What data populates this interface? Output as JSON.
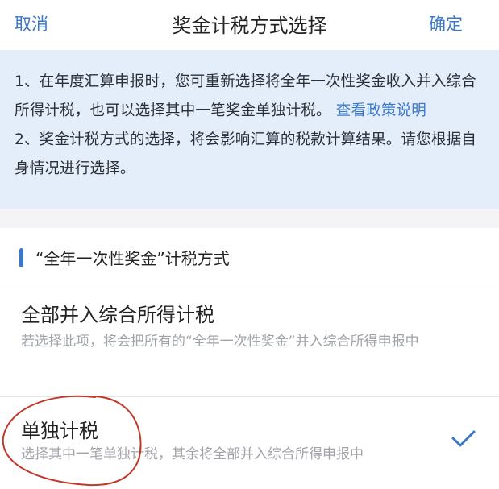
{
  "nav": {
    "cancel_label": "取消",
    "title": "奖金计税方式选择",
    "confirm_label": "确定"
  },
  "notice": {
    "line1_text": "1、在年度汇算申报时，您可重新选择将全年一次性奖金收入并入综合所得计税，也可以选择其中一笔奖金单独计税。",
    "line1_link": "查看政策说明",
    "line2_text": "2、奖金计税方式的选择，将会影响汇算的税款计算结果。请您根据自身情况进行选择。"
  },
  "section": {
    "title": "“全年一次性奖金”计税方式"
  },
  "options": [
    {
      "title": "全部并入综合所得计税",
      "description": "若选择此项，将会把所有的“全年一次性奖金”并入综合所得申报中",
      "selected": false
    },
    {
      "title": "单独计税",
      "description": "选择其中一笔单独计税，其余将全部并入综合所得申报中",
      "selected": true
    }
  ],
  "colors": {
    "accent": "#3a78c9",
    "notice_bg": "#e4eefb",
    "annotation": "#c0392b"
  }
}
